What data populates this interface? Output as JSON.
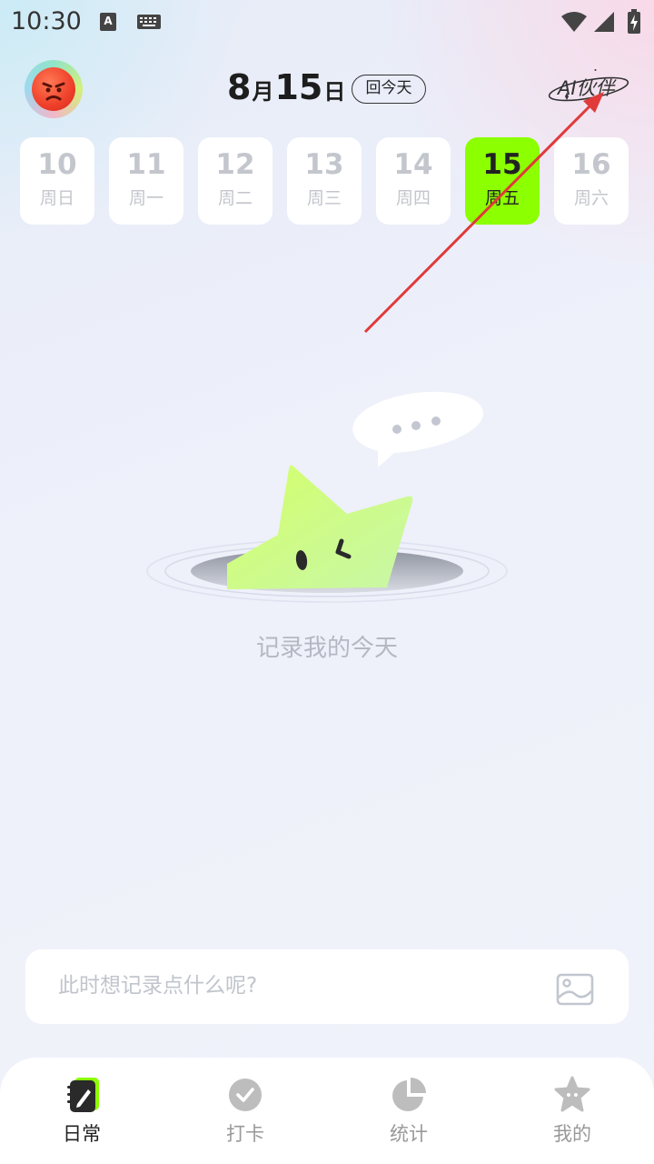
{
  "status_bar": {
    "time": "10:30",
    "icons": [
      "a11y-icon",
      "keyboard-icon",
      "wifi-icon",
      "signal-icon",
      "battery-charging-icon"
    ]
  },
  "header": {
    "month_num": "8",
    "month_unit": "月",
    "day_num": "15",
    "day_unit": "日",
    "today_button": "回今天",
    "ai_button": "AI伙伴"
  },
  "days": [
    {
      "num": "10",
      "week": "周日",
      "active": false
    },
    {
      "num": "11",
      "week": "周一",
      "active": false
    },
    {
      "num": "12",
      "week": "周二",
      "active": false
    },
    {
      "num": "13",
      "week": "周三",
      "active": false
    },
    {
      "num": "14",
      "week": "周四",
      "active": false
    },
    {
      "num": "15",
      "week": "周五",
      "active": true
    },
    {
      "num": "16",
      "week": "周六",
      "active": false
    }
  ],
  "empty_state": {
    "text": "记录我的今天"
  },
  "input": {
    "placeholder": "此时想记录点什么呢?",
    "value": ""
  },
  "nav": {
    "items": [
      {
        "label": "日常",
        "icon": "journal-icon",
        "active": true
      },
      {
        "label": "打卡",
        "icon": "check-circle-icon",
        "active": false
      },
      {
        "label": "统计",
        "icon": "pie-chart-icon",
        "active": false
      },
      {
        "label": "我的",
        "icon": "star-face-icon",
        "active": false
      }
    ]
  },
  "colors": {
    "accent": "#8cff00",
    "annotation_arrow": "#e03a3a",
    "muted_text": "#b4b8c2"
  }
}
